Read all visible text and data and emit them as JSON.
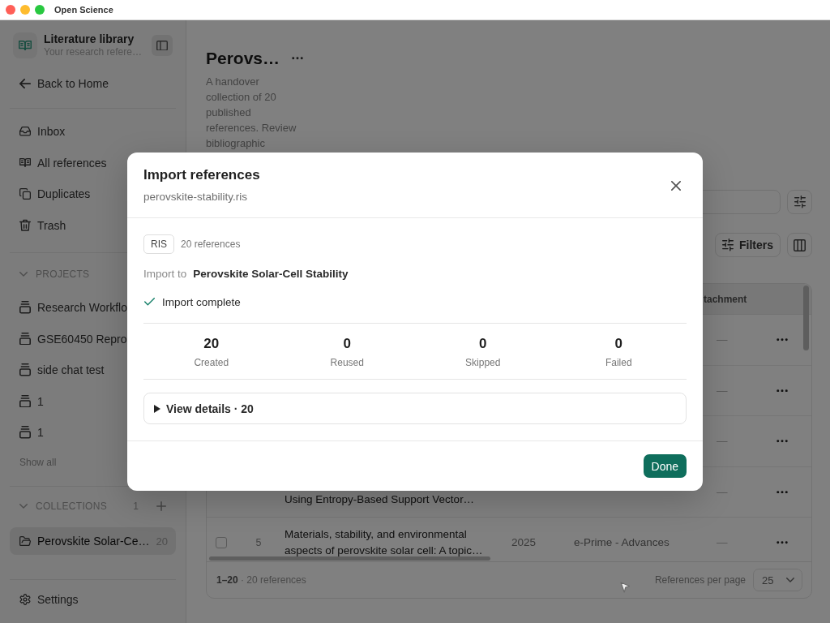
{
  "window": {
    "title": "Open Science"
  },
  "sidebar": {
    "header": {
      "title": "Literature library",
      "subtitle": "Your research refere…"
    },
    "back": "Back to Home",
    "nav": [
      {
        "label": "Inbox",
        "selected": false
      },
      {
        "label": "All references",
        "selected": false
      },
      {
        "label": "Duplicates",
        "selected": false
      },
      {
        "label": "Trash",
        "selected": false
      }
    ],
    "projects": {
      "heading": "PROJECTS",
      "expanded": true,
      "items": [
        {
          "label": "Research Workflo",
          "selected": false
        },
        {
          "label": "GSE60450 Repro",
          "selected": false
        },
        {
          "label": "side chat test",
          "selected": false
        },
        {
          "label": "1",
          "selected": false
        },
        {
          "label": "1",
          "selected": false
        }
      ],
      "show_all": "Show all"
    },
    "collections": {
      "heading": "COLLECTIONS",
      "expanded": true,
      "count": "1",
      "items": [
        {
          "label": "Perovskite Solar-Ce…",
          "count": "20",
          "selected": true
        }
      ]
    },
    "settings": "Settings"
  },
  "main": {
    "title": "Perovs…",
    "description": "A handover collection of 20 published references. Review bibliographic",
    "filters_button": "Filters",
    "table": {
      "columns": [
        {
          "label": "tachment"
        }
      ],
      "rows": [
        {
          "attachment": "—"
        },
        {
          "attachment": "—"
        },
        {
          "attachment": "—"
        },
        {
          "title": "Using Entropy-Based Support Vector…",
          "attachment": "—"
        },
        {
          "checked": false,
          "number": "5",
          "title": "Materials, stability, and environmental aspects of perovskite solar cell: A topic…",
          "year": "2025",
          "journal": "e-Prime - Advances",
          "attachment": "—"
        }
      ],
      "footer": {
        "range": "**1–20** · 20 references",
        "per_page_label": "References per page",
        "per_page": "25"
      }
    }
  },
  "dialog": {
    "title": "Import references",
    "file": "perovskite-stability.ris",
    "format": "RIS",
    "reference_count": "20 references",
    "target_label": "Import to",
    "target": "Perovskite Solar-Cell Stability",
    "status": "Import complete",
    "stats": [
      {
        "value": "20",
        "label": "Created"
      },
      {
        "value": "0",
        "label": "Reused"
      },
      {
        "value": "0",
        "label": "Skipped"
      },
      {
        "value": "0",
        "label": "Failed"
      }
    ],
    "details": {
      "label": "View details · 20",
      "expanded": false
    },
    "done": "Done"
  }
}
